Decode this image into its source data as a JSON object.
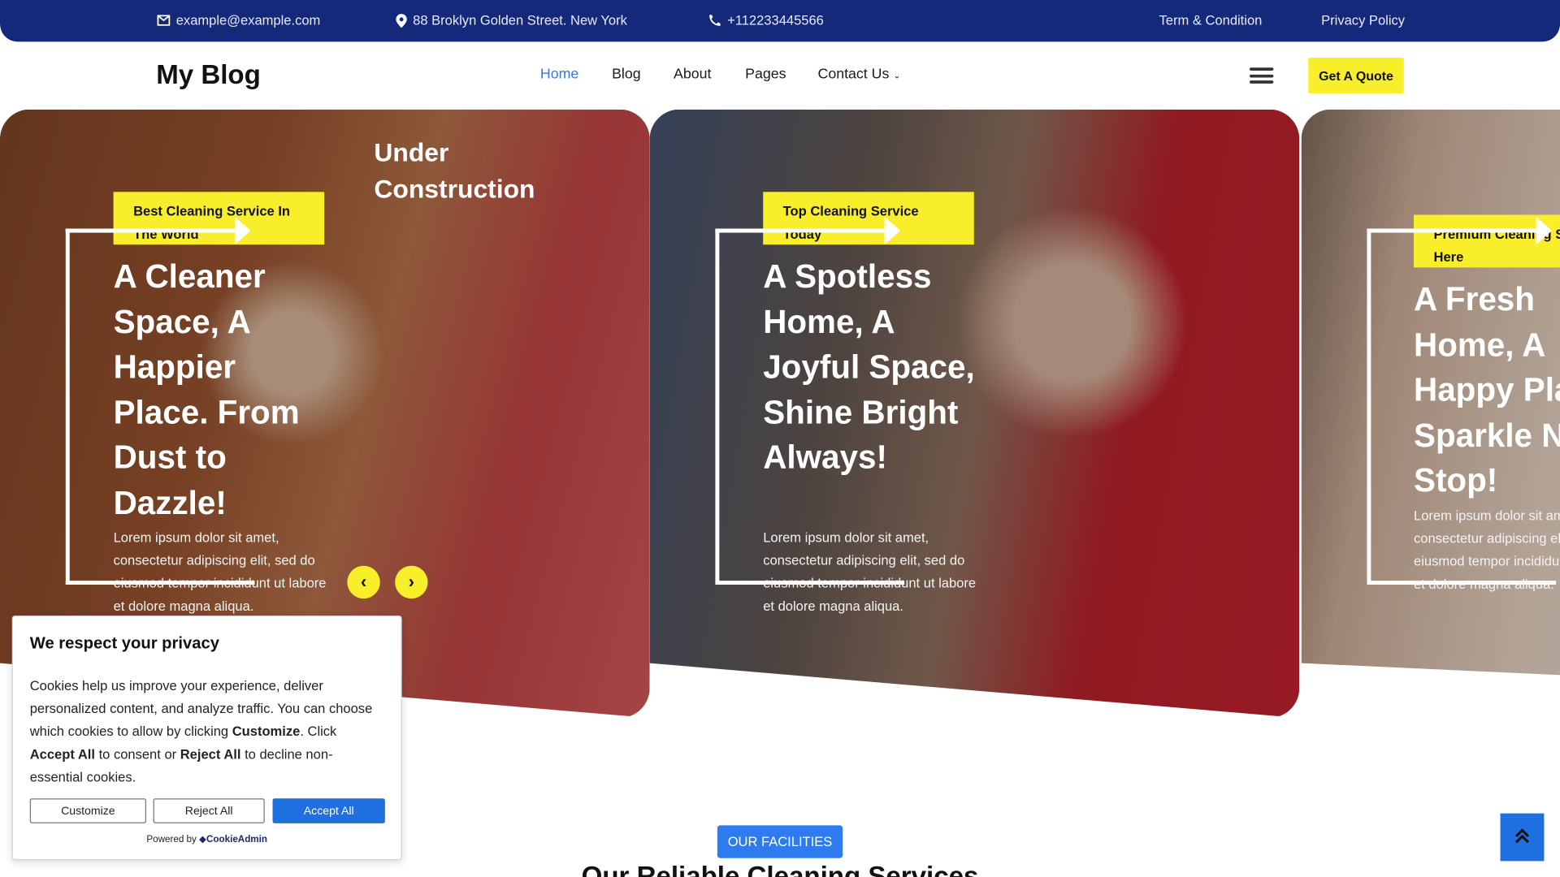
{
  "topbar": {
    "email": "example@example.com",
    "address": "88 Broklyn Golden Street. New York",
    "phone": "+112233445566",
    "terms": "Term & Condition",
    "privacy": "Privacy Policy"
  },
  "header": {
    "logo": "My Blog",
    "nav": [
      "Home",
      "Blog",
      "About",
      "Pages",
      "Contact Us"
    ],
    "quote": "Get A Quote"
  },
  "hero": {
    "under_construction": "Under Construction",
    "slides": [
      {
        "tag": "Best Cleaning Service In The World",
        "title": "A Cleaner Space, A Happier Place. From Dust to Dazzle!",
        "body": "Lorem ipsum dolor sit amet, consectetur adipiscing elit, sed do eiusmod tempor incididunt ut labore et dolore magna aliqua."
      },
      {
        "tag": "Top Cleaning Service Today",
        "title": "A Spotless Home, A Joyful Space, Shine Bright Always!",
        "body": "Lorem ipsum dolor sit amet, consectetur adipiscing elit, sed do eiusmod tempor incididunt ut labore et dolore magna aliqua."
      },
      {
        "tag": "Premium Cleaning Service Here",
        "title": "A Fresh Home, A Happy Place, Sparkle Non-Stop!",
        "body": "Lorem ipsum dolor sit amet, consectetur adipiscing elit, sed do eiusmod tempor incididunt ut labore et dolore magna aliqua."
      }
    ],
    "prev": "‹",
    "next": "›"
  },
  "cookie": {
    "title": "We respect your privacy",
    "text_1": "Cookies help us improve your experience, deliver personalized content, and analyze traffic. You can choose which cookies to allow by clicking ",
    "customize_word": "Customize",
    "text_2": ". Click ",
    "accept_word": "Accept All",
    "text_3": " to consent or ",
    "reject_word": "Reject All",
    "text_4": " to decline non-essential cookies.",
    "customize": "Customize",
    "reject": "Reject All",
    "accept": "Accept All",
    "powered": "Powered by",
    "brand": "CookieAdmin"
  },
  "facilities": {
    "badge": "OUR FACILITIES",
    "heading": "Our Reliable Cleaning Services"
  },
  "colors": {
    "navy": "#15297a",
    "yellow": "#f8ee2b",
    "blue": "#2e7bf0"
  }
}
